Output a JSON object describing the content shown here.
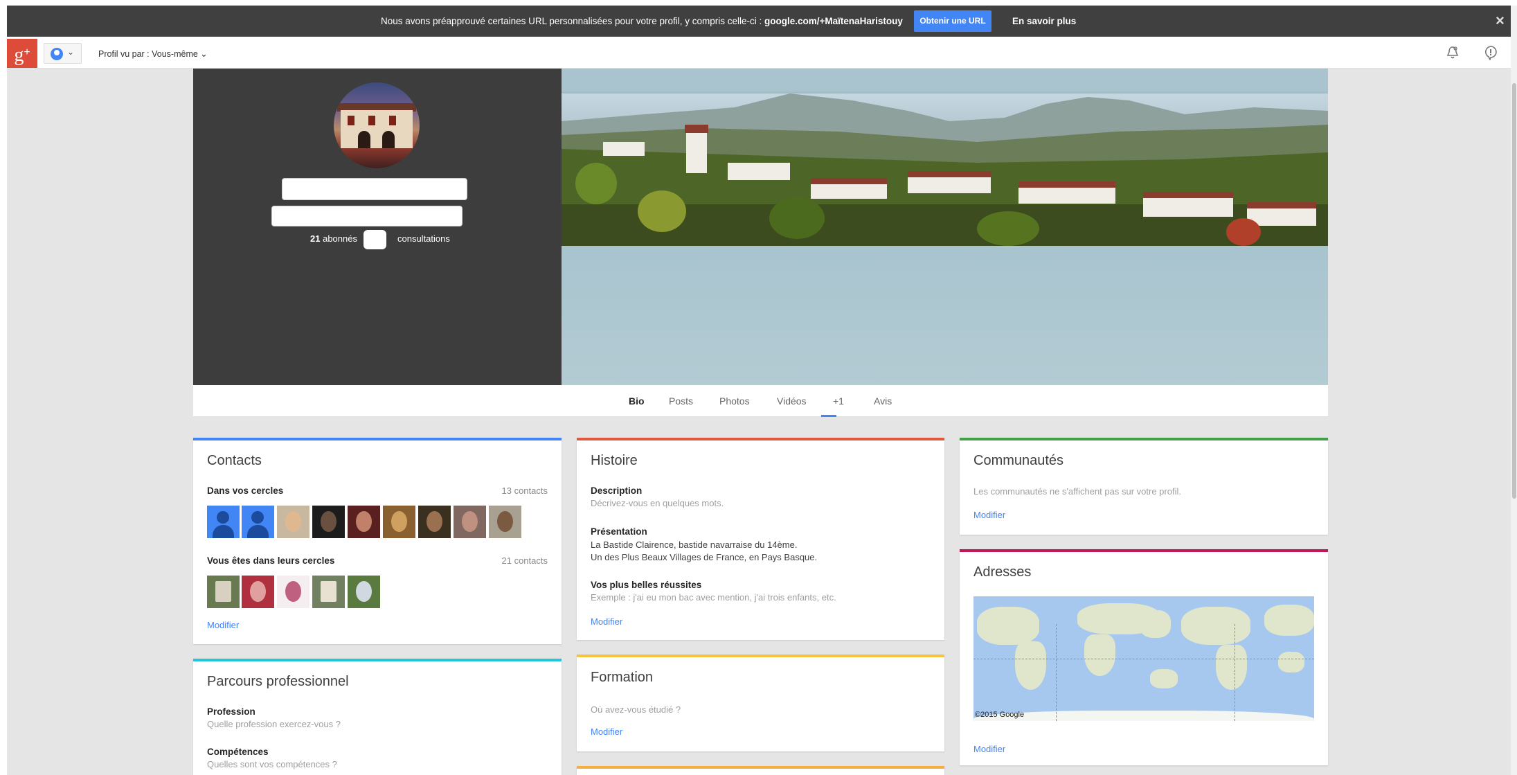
{
  "notification": {
    "message_prefix": "Nous avons préapprouvé certaines URL personnalisées pour votre profil, y compris celle-ci : ",
    "message_url": "google.com/+MaïtenaHaristouy",
    "get_url_label": "Obtenir une URL",
    "learn_more_label": "En savoir plus",
    "close_symbol": "×"
  },
  "appbar": {
    "logo_text": "g",
    "logo_plus": "+",
    "viewed_by_label": "Profil vu par : Vous-même ⌄",
    "icons": [
      "notifications-icon",
      "feedback-icon"
    ]
  },
  "profile": {
    "followers_count": "21",
    "followers_label": "abonnés",
    "views_label": "consultations"
  },
  "tabs": [
    "Bio",
    "Posts",
    "Photos",
    "Vidéos",
    "+1",
    "Avis"
  ],
  "active_tab": "Bio",
  "contacts": {
    "title": "Contacts",
    "in_circles_label": "Dans vos cercles",
    "in_circles_count": "13 contacts",
    "their_circles_label": "Vous êtes dans leurs cercles",
    "their_circles_count": "21 contacts",
    "edit": "Modifier",
    "accent": "#4285f4"
  },
  "career": {
    "title": "Parcours professionnel",
    "profession_label": "Profession",
    "profession_hint": "Quelle profession exercez-vous ?",
    "skills_label": "Compétences",
    "skills_hint": "Quelles sont vos compétences ?",
    "accent": "#26c6da"
  },
  "story": {
    "title": "Histoire",
    "description_label": "Description",
    "description_hint": "Décrivez-vous en quelques mots.",
    "presentation_label": "Présentation",
    "presentation_line1": "La Bastide Clairence, bastide navarraise du 14ème.",
    "presentation_line2": "Un des Plus Beaux Villages de France, en Pays Basque.",
    "achievements_label": "Vos plus belles réussites",
    "achievements_hint": "Exemple : j'ai eu mon bac avec mention, j'ai trois enfants, etc.",
    "edit": "Modifier",
    "accent": "#e0583e"
  },
  "education": {
    "title": "Formation",
    "hint": "Où avez-vous étudié ?",
    "edit": "Modifier",
    "accent": "#f6c342"
  },
  "communities": {
    "title": "Communautés",
    "hint": "Les communautés ne s'affichent pas sur votre profil.",
    "edit": "Modifier",
    "accent": "#43a047"
  },
  "addresses": {
    "title": "Adresses",
    "map_credit": "©2015 Google",
    "edit": "Modifier",
    "accent": "#c2185b"
  }
}
